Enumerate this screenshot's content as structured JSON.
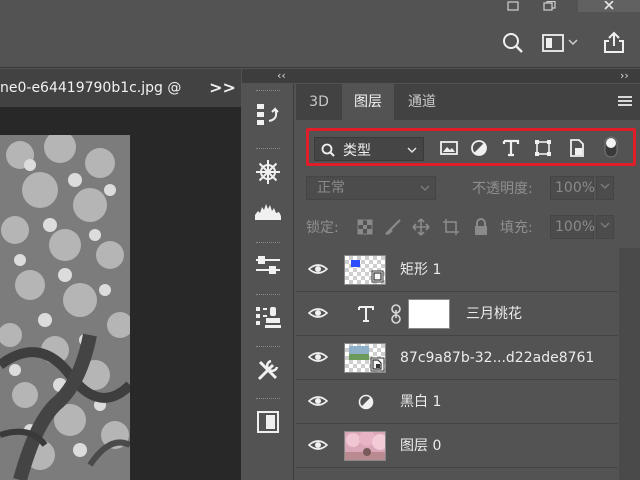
{
  "app": {
    "document_tab": "ne0-e64419790b1c.jpg @",
    "document_more": ">>"
  },
  "panel": {
    "collapse_left": "‹‹",
    "collapse_right": "››",
    "tabs": [
      {
        "label": "3D",
        "active": false
      },
      {
        "label": "图层",
        "active": true
      },
      {
        "label": "通道",
        "active": false
      }
    ],
    "filter": {
      "kind_label": "类型",
      "highlight_color": "#e21d2a"
    },
    "blend": {
      "mode": "正常",
      "opacity_label": "不透明度:",
      "opacity_value": "100%"
    },
    "lock": {
      "label": "锁定:",
      "fill_label": "填充:",
      "fill_value": "100%"
    },
    "layers": [
      {
        "name": "矩形 1",
        "type": "shape",
        "visible": true
      },
      {
        "name": "三月桃花",
        "type": "text",
        "visible": true
      },
      {
        "name": "87c9a87b-32...d22ade8761",
        "type": "smart-object",
        "visible": true
      },
      {
        "name": "黑白 1",
        "type": "adjustment",
        "visible": true
      },
      {
        "name": "图层 0",
        "type": "image",
        "visible": true
      }
    ]
  },
  "colors": {
    "ui_bg": "#535353",
    "dark_bg": "#424242",
    "accent_red": "#e21d2a"
  }
}
